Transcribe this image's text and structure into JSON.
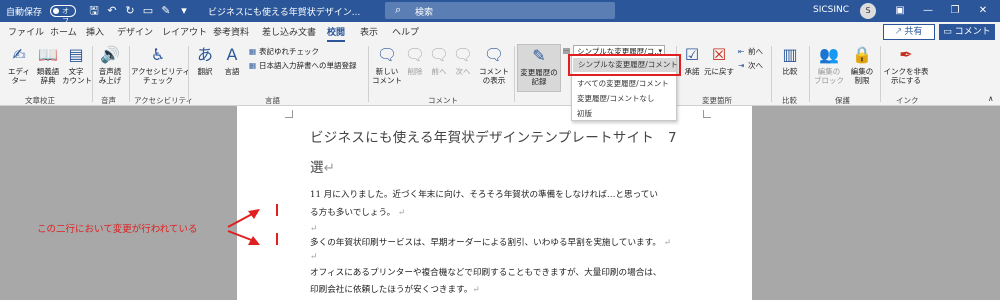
{
  "titlebar": {
    "autosave_label": "自動保存",
    "autosave_state": "オフ",
    "doc_title": "ビジネスにも使える年賀状デザイン...",
    "search_placeholder": "検索",
    "user_name": "SICSINC",
    "avatar_initial": "S"
  },
  "tabs": [
    "ファイル",
    "ホーム",
    "挿入",
    "デザイン",
    "レイアウト",
    "参考資料",
    "差し込み文書",
    "校閲",
    "表示",
    "ヘルプ"
  ],
  "active_tab": "校閲",
  "share_label": "共有",
  "comment_label": "コメント",
  "ribbon": {
    "editor": "エディ\nター",
    "thesaurus": "類義語\n辞典",
    "wordcount": "文字\nカウント",
    "readaloud": "音声読\nみ上げ",
    "accessibility": "アクセシビリティ\nチェック",
    "translate": "翻訳",
    "language": "言語",
    "ime_check": "表記ゆれチェック",
    "ime_dict": "日本語入力辞書への単語登録",
    "new_comment": "新しい\nコメント",
    "delete": "削除",
    "prev": "前へ",
    "next": "次へ",
    "show_comments": "コメント\nの表示",
    "track_changes": "変更履歴の\n記録",
    "track_select": "シンプルな変更履歴/コ...",
    "accept": "承諾",
    "reject": "元に戻す",
    "prev_change": "前へ",
    "next_change": "次へ",
    "compare": "比較",
    "block_authors": "編集の\nブロック",
    "restrict_editing": "編集の\n制限",
    "hide_ink": "インクを非表\n示にする",
    "groups": {
      "proofing": "文章校正",
      "speech": "音声",
      "accessibility": "アクセシビリティ",
      "language": "言語",
      "comments": "コメント",
      "changes": "変更箇所",
      "compare": "比較",
      "protect": "保護",
      "ink": "インク"
    }
  },
  "dropdown": {
    "items": [
      "シンプルな変更履歴/コメント",
      "すべての変更履歴/コメント",
      "変更履歴/コメントなし",
      "初版"
    ]
  },
  "document": {
    "title_line1": "ビジネスにも使える年賀状デザインテンプレートサイト　7",
    "title_line2": "選",
    "p1_line1": "11 月に入りました。近づく年末に向け、そろそろ年賀状の準備をしなければ…と思ってい",
    "p1_line2": "る方も多いでしょう。",
    "p2_line1": "多くの年賀状印刷サービスは、早期オーダーによる割引、いわゆる早割を実施しています。",
    "p3_line1": "オフィスにあるプリンターや複合機などで印刷することもできますが、大量印刷の場合は、",
    "p3_line2": "印刷会社に依頼したほうが安くつきます。"
  },
  "annotation": "この二行において変更が行われている",
  "colors": {
    "brand": "#2b579a",
    "highlight": "#e02020"
  }
}
